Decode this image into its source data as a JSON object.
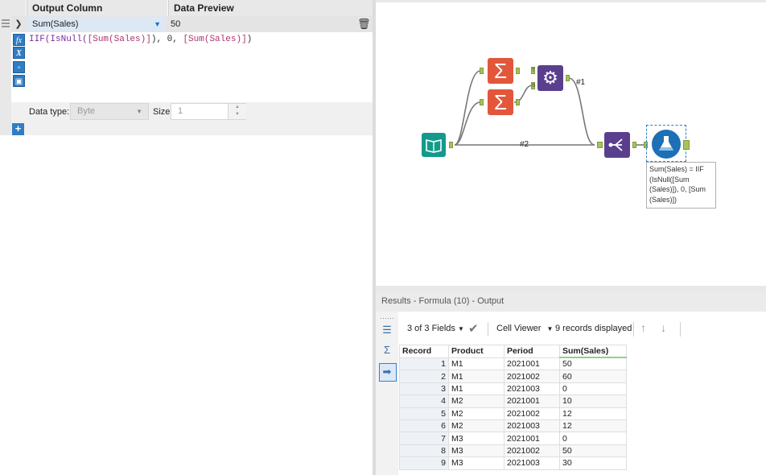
{
  "formula": {
    "headers": {
      "output_column": "Output Column",
      "data_preview": "Data Preview"
    },
    "row": {
      "output_column": "Sum(Sales)",
      "preview": "50"
    },
    "expression": {
      "fn": "IIF(",
      "fn2": "IsNull(",
      "field1": "[Sum(Sales)]",
      "mid": "), 0, ",
      "field2": "[Sum(Sales)]",
      "end": ")"
    },
    "side_buttons": [
      "fx",
      "X",
      "folder",
      "save"
    ],
    "data_type_label": "Data type:",
    "data_type_value": "Byte",
    "size_label": "Size:",
    "size_value": "1",
    "add_label": "+"
  },
  "canvas": {
    "annotation": "Sum(Sales) = IIF (IsNull([Sum (Sales)]), 0, [Sum (Sales)])",
    "connection_labels": [
      "#1",
      "#2"
    ],
    "anchor_labels": [
      "T",
      "S",
      "L",
      "R"
    ],
    "colors": {
      "input": "#149a8c",
      "summarize": "#e2573b",
      "join": "#5a3f8e",
      "union": "#5a3f8e",
      "formula": "#1d6fb6"
    }
  },
  "results": {
    "title": "Results - Formula (10) - Output",
    "fields_label": "3 of 3 Fields",
    "viewer_label": "Cell Viewer",
    "records_label": "9 records displayed",
    "columns": [
      "Record",
      "Product",
      "Period",
      "Sum(Sales)"
    ],
    "rows": [
      [
        "1",
        "M1",
        "2021001",
        "50"
      ],
      [
        "2",
        "M1",
        "2021002",
        "60"
      ],
      [
        "3",
        "M1",
        "2021003",
        "0"
      ],
      [
        "4",
        "M2",
        "2021001",
        "10"
      ],
      [
        "5",
        "M2",
        "2021002",
        "12"
      ],
      [
        "6",
        "M2",
        "2021003",
        "12"
      ],
      [
        "7",
        "M3",
        "2021001",
        "0"
      ],
      [
        "8",
        "M3",
        "2021002",
        "50"
      ],
      [
        "9",
        "M3",
        "2021003",
        "30"
      ]
    ]
  }
}
